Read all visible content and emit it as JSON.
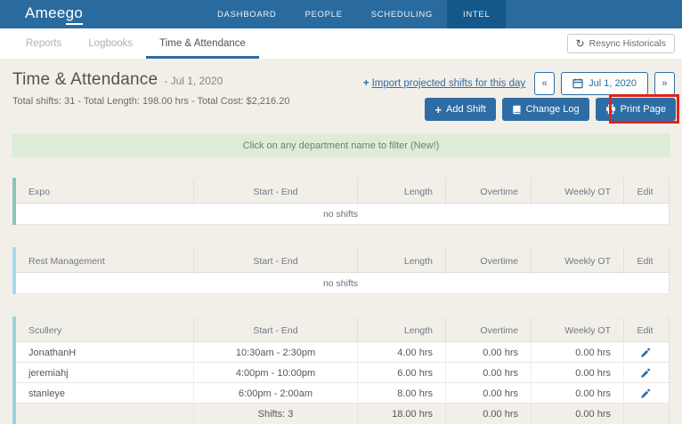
{
  "colors": {
    "navbar_bg": "#2a6b9f",
    "navbar_active_bg": "#14578b",
    "accent_blue": "#2e6da4",
    "highlight_red": "#e0241b",
    "banner_bg": "#dcecd8",
    "page_bg": "#f2efe9",
    "department_link": "#4089b5",
    "expo_accent": "#8cc5b6",
    "rest_management_accent": "#a6daf0",
    "scullery_accent": "#9cd2e0"
  },
  "navbar": {
    "brand_prefix": "Amee",
    "brand_suffix": "go",
    "items": [
      {
        "label": "DASHBOARD"
      },
      {
        "label": "PEOPLE"
      },
      {
        "label": "SCHEDULING"
      },
      {
        "label": "INTEL"
      }
    ]
  },
  "subnav": {
    "tabs": [
      {
        "label": "Reports"
      },
      {
        "label": "Logbooks"
      },
      {
        "label": "Time & Attendance"
      }
    ],
    "resync_button": "Resync Historicals",
    "resync_icon": "↻"
  },
  "page": {
    "title": "Time & Attendance",
    "date_suffix": "- Jul 1, 2020",
    "totals": "Total shifts: 31 - Total Length: 198.00 hrs - Total Cost: $2,216.20",
    "import_plus": "+",
    "import_link": "Import projected shifts for this day",
    "date_nav": {
      "prev": "«",
      "date": "Jul 1, 2020",
      "next": "»"
    },
    "actions": {
      "add_shift_plus": "+",
      "add_shift": "Add Shift",
      "change_log": "Change Log",
      "print_page": "Print Page"
    },
    "banner": "Click on any department name to filter (New!)"
  },
  "columns": {
    "start_end": "Start - End",
    "length": "Length",
    "overtime": "Overtime",
    "weekly_ot": "Weekly OT",
    "edit": "Edit"
  },
  "tables": [
    {
      "department": "Expo",
      "empty": "no shifts",
      "rows": []
    },
    {
      "department": "Rest Management",
      "empty": "no shifts",
      "rows": []
    },
    {
      "department": "Scullery",
      "rows": [
        {
          "name": "JonathanH",
          "time": "10:30am - 2:30pm",
          "length": "4.00 hrs",
          "overtime": "0.00 hrs",
          "weekly_ot": "0.00 hrs"
        },
        {
          "name": "jeremiahj",
          "time": "4:00pm - 10:00pm",
          "length": "6.00 hrs",
          "overtime": "0.00 hrs",
          "weekly_ot": "0.00 hrs"
        },
        {
          "name": "stanleye",
          "time": "6:00pm - 2:00am",
          "length": "8.00 hrs",
          "overtime": "0.00 hrs",
          "weekly_ot": "0.00 hrs"
        }
      ],
      "summary": {
        "label": "Shifts: 3",
        "length": "18.00 hrs",
        "overtime": "0.00 hrs",
        "weekly_ot": "0.00 hrs"
      }
    }
  ]
}
